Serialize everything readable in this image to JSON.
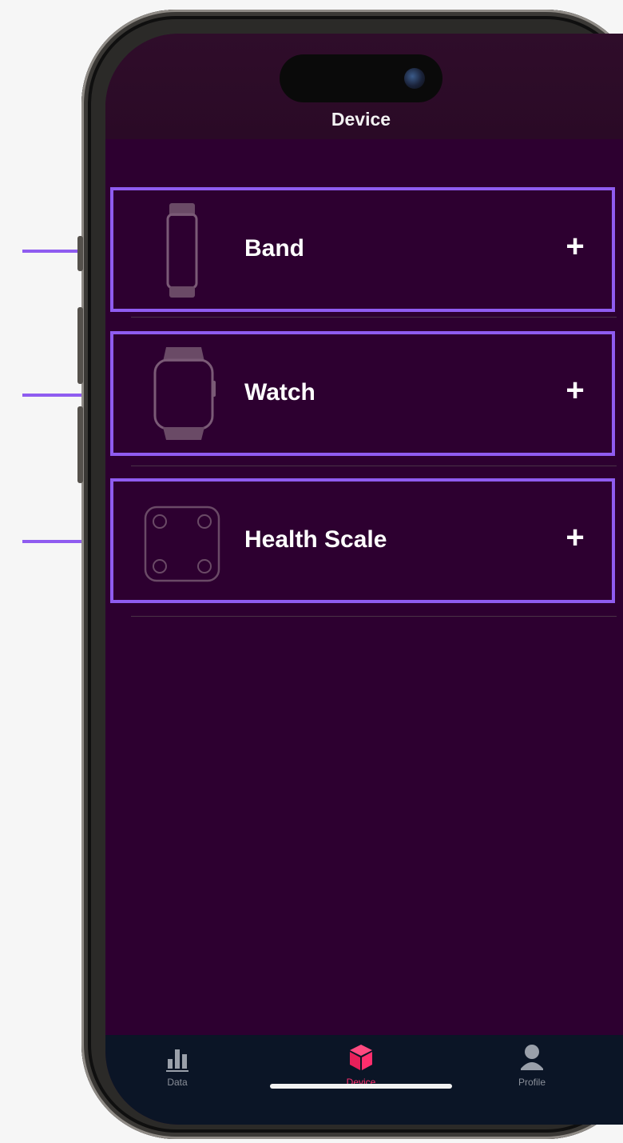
{
  "header": {
    "title": "Device"
  },
  "devices": [
    {
      "label": "Band",
      "icon": "band-icon",
      "action": "+"
    },
    {
      "label": "Watch",
      "icon": "watch-icon",
      "action": "+"
    },
    {
      "label": "Health Scale",
      "icon": "scale-icon",
      "action": "+"
    }
  ],
  "tabs": [
    {
      "label": "Data",
      "icon": "bar-chart-icon",
      "active": false
    },
    {
      "label": "Device",
      "icon": "cube-icon",
      "active": true
    },
    {
      "label": "Profile",
      "icon": "person-icon",
      "active": false
    }
  ],
  "colors": {
    "background": "#2d0030",
    "highlight_border": "#8f5cf0",
    "active_tab": "#ff2e6d",
    "tab_bar": "#0b1526"
  }
}
